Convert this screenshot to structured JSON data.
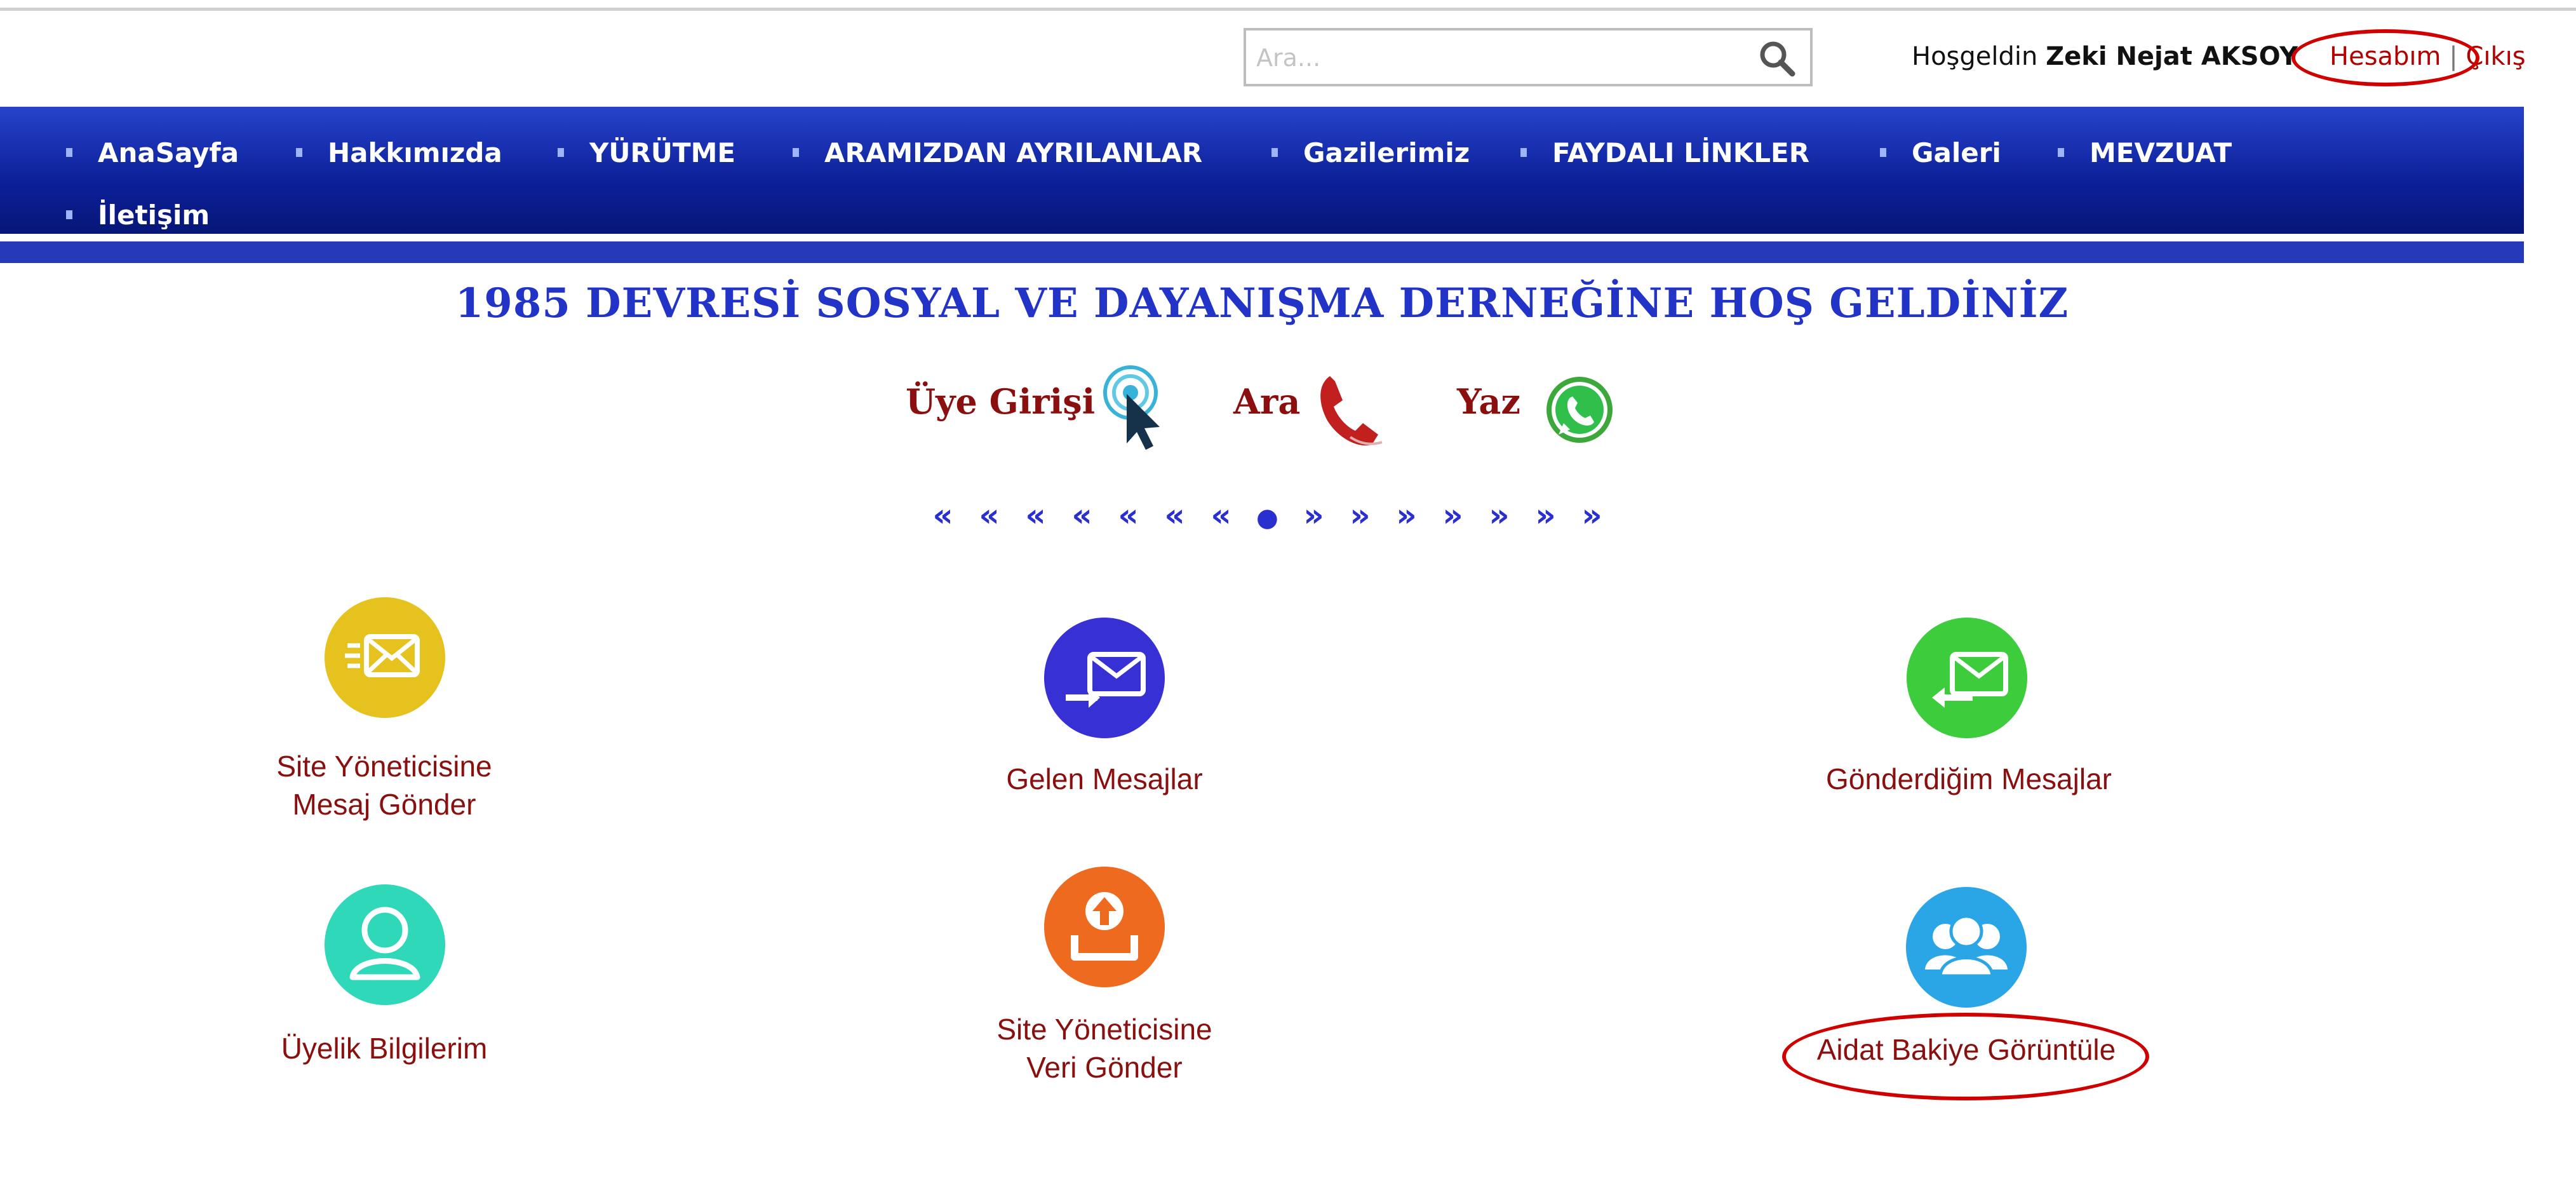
{
  "search": {
    "placeholder": "Ara..."
  },
  "header": {
    "welcome_prefix": "Hoşgeldin",
    "user_name": "Zeki Nejat AKSOY",
    "account_link": "Hesabım",
    "separator": "|",
    "logout_link": "Çıkış"
  },
  "nav": {
    "items": [
      {
        "label": "AnaSayfa"
      },
      {
        "label": "Hakkımızda"
      },
      {
        "label": "YÜRÜTME"
      },
      {
        "label": "ARAMIZDAN AYRILANLAR"
      },
      {
        "label": "Gazilerimiz"
      },
      {
        "label": "FAYDALI LİNKLER"
      },
      {
        "label": "Galeri"
      },
      {
        "label": "MEVZUAT"
      },
      {
        "label": "İletişim"
      }
    ]
  },
  "page": {
    "title": "1985 DEVRESİ SOSYAL VE DAYANIŞMA DERNEĞİNE  HOŞ GELDİNİZ"
  },
  "quick_links": {
    "login": "Üye Girişi",
    "call": "Ara",
    "write": "Yaz"
  },
  "pager": {
    "prev": [
      "«",
      "«",
      "«",
      "«",
      "«",
      "«",
      "«"
    ],
    "current": "●",
    "next": [
      "»",
      "»",
      "»",
      "»",
      "»",
      "»",
      "»"
    ]
  },
  "tiles": {
    "send_admin_message": {
      "line1": "Site Yöneticisine",
      "line2": "Mesaj Gönder",
      "icon": "send-mail-icon",
      "color": "#e6c21e"
    },
    "inbox": {
      "line1": "Gelen Mesajlar",
      "icon": "incoming-mail-icon",
      "color": "#3730d4"
    },
    "sent": {
      "line1": "Gönderdiğim Mesajlar",
      "icon": "outgoing-mail-icon",
      "color": "#3ccc3c"
    },
    "membership": {
      "line1": "Üyelik Bilgilerim",
      "icon": "user-icon",
      "color": "#2ed8b8"
    },
    "upload_data": {
      "line1": "Site Yöneticisine",
      "line2": "Veri Gönder",
      "icon": "upload-icon",
      "color": "#ee6a1e"
    },
    "dues_balance": {
      "line1": "Aidat Bakiye Görüntüle",
      "icon": "group-icon",
      "color": "#2aa6e6"
    }
  },
  "annotation_color": "#d10000"
}
